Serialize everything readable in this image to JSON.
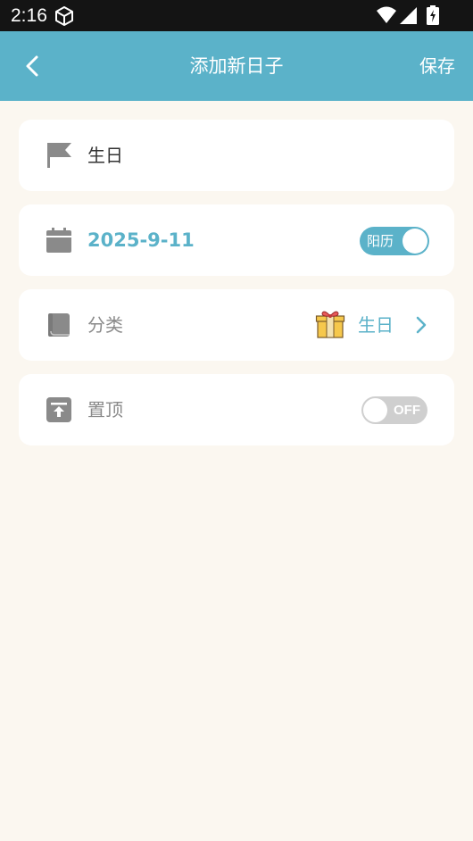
{
  "status_bar": {
    "time": "2:16"
  },
  "app_bar": {
    "title": "添加新日子",
    "save_label": "保存"
  },
  "name_row": {
    "value": "生日",
    "icon": "flag-icon"
  },
  "date_row": {
    "value": "2025-9-11",
    "icon": "calendar-icon",
    "calendar_toggle_label": "阳历",
    "calendar_toggle_on": true
  },
  "category_row": {
    "label": "分类",
    "value": "生日",
    "icon": "book-icon",
    "value_icon": "gift-icon"
  },
  "pin_row": {
    "label": "置顶",
    "toggle_label": "OFF",
    "toggle_on": false,
    "icon": "pin-top-icon"
  },
  "colors": {
    "accent": "#5BB2C9",
    "background": "#FBF7F0",
    "status_bar": "#141414"
  }
}
